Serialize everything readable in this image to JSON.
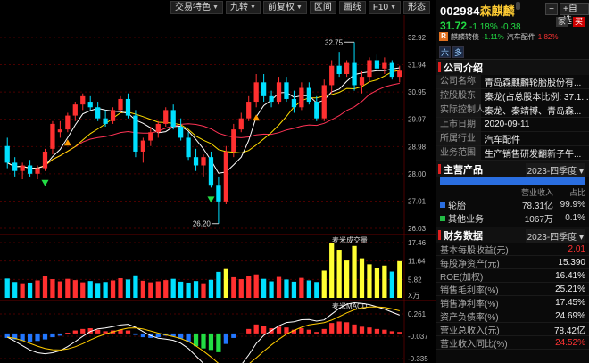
{
  "toolbar": {
    "buttons": [
      {
        "label": "交易特色",
        "caret": true
      },
      {
        "label": "九转",
        "caret": true
      },
      {
        "label": "前复权",
        "caret": true
      },
      {
        "label": "区间",
        "caret": false
      },
      {
        "label": "画线",
        "caret": false
      },
      {
        "label": "F10",
        "caret": true
      },
      {
        "label": "形态",
        "caret": false
      }
    ]
  },
  "chart": {
    "price_axis_labels": [
      "32.92",
      "31.94",
      "30.95",
      "29.97",
      "28.98",
      "28.00",
      "27.01",
      "26.03"
    ],
    "high_marker": "32.75",
    "low_marker": "26.20",
    "volume_title": "麦米成交量",
    "volume_axis_labels": [
      "17.46",
      "11.64",
      "5.82"
    ],
    "volume_unit": "X万",
    "macd_title": "麦米MACD",
    "macd_axis_labels": [
      "0.261",
      "-0.037",
      "-0.335"
    ],
    "colors": {
      "up": "#ff3030",
      "down": "#00e0ff",
      "ma5": "#ffffff",
      "ma10": "#ffdd00",
      "ma20": "#ff3355",
      "grid": "#4a0000"
    }
  },
  "chart_data": [
    {
      "type": "candlestick",
      "ylim": [
        26.03,
        32.92
      ],
      "ohlc": [
        [
          29.0,
          29.3,
          28.2,
          28.4
        ],
        [
          28.4,
          28.6,
          27.9,
          28.1
        ],
        [
          28.1,
          28.4,
          27.8,
          28.3
        ],
        [
          28.3,
          28.5,
          27.9,
          28.0
        ],
        [
          28.0,
          28.3,
          27.8,
          28.2
        ],
        [
          28.2,
          28.9,
          28.1,
          28.8
        ],
        [
          28.9,
          29.9,
          28.7,
          29.8
        ],
        [
          29.5,
          29.9,
          29.3,
          29.6
        ],
        [
          29.6,
          30.2,
          29.5,
          30.1
        ],
        [
          30.1,
          30.6,
          29.9,
          30.5
        ],
        [
          30.5,
          30.9,
          30.3,
          30.8
        ],
        [
          30.6,
          30.8,
          30.3,
          30.4
        ],
        [
          30.4,
          30.6,
          29.9,
          30.0
        ],
        [
          30.0,
          30.3,
          29.7,
          29.8
        ],
        [
          29.9,
          30.4,
          29.8,
          30.3
        ],
        [
          30.3,
          30.8,
          30.2,
          30.7
        ],
        [
          30.7,
          30.9,
          30.0,
          30.1
        ],
        [
          30.1,
          30.3,
          28.6,
          28.8
        ],
        [
          28.8,
          29.3,
          28.4,
          29.2
        ],
        [
          29.2,
          29.7,
          29.0,
          29.5
        ],
        [
          29.5,
          29.9,
          29.3,
          29.8
        ],
        [
          29.8,
          30.4,
          29.7,
          30.3
        ],
        [
          30.3,
          30.5,
          29.6,
          29.7
        ],
        [
          29.7,
          30.0,
          29.2,
          29.3
        ],
        [
          29.3,
          29.5,
          28.5,
          28.6
        ],
        [
          28.6,
          28.9,
          28.1,
          28.3
        ],
        [
          28.3,
          28.7,
          27.9,
          28.6
        ],
        [
          28.6,
          28.8,
          27.5,
          27.6
        ],
        [
          27.6,
          27.9,
          26.2,
          27.0
        ],
        [
          27.0,
          29.0,
          26.9,
          28.8
        ],
        [
          28.8,
          29.8,
          28.6,
          29.6
        ],
        [
          29.6,
          30.2,
          29.5,
          30.0
        ],
        [
          30.0,
          30.8,
          29.9,
          30.6
        ],
        [
          30.6,
          31.6,
          30.4,
          31.3
        ],
        [
          31.3,
          31.6,
          30.6,
          30.8
        ],
        [
          30.8,
          31.0,
          30.4,
          30.6
        ],
        [
          30.6,
          31.5,
          30.5,
          31.3
        ],
        [
          31.3,
          31.5,
          30.6,
          30.7
        ],
        [
          30.7,
          31.0,
          30.2,
          30.4
        ],
        [
          30.4,
          31.3,
          30.3,
          31.1
        ],
        [
          31.1,
          31.3,
          30.5,
          30.6
        ],
        [
          30.6,
          30.8,
          29.9,
          30.0
        ],
        [
          30.0,
          31.4,
          29.9,
          31.2
        ],
        [
          31.2,
          32.1,
          30.9,
          31.9
        ],
        [
          31.9,
          32.4,
          31.5,
          31.6
        ],
        [
          31.6,
          32.1,
          31.5,
          32.0
        ],
        [
          32.0,
          32.75,
          31.0,
          31.2
        ],
        [
          31.2,
          31.7,
          30.9,
          31.5
        ],
        [
          31.5,
          32.2,
          31.3,
          32.1
        ],
        [
          32.1,
          32.3,
          31.7,
          31.8
        ],
        [
          31.8,
          32.2,
          31.6,
          32.0
        ],
        [
          32.0,
          32.1,
          31.4,
          31.5
        ],
        [
          31.5,
          31.9,
          31.3,
          31.72
        ]
      ]
    },
    {
      "type": "bar",
      "name": "volume",
      "ylim": [
        0,
        17.46
      ],
      "values": [
        6.1,
        5.0,
        4.6,
        4.8,
        5.5,
        6.8,
        5.9,
        5.2,
        6.0,
        5.6,
        4.9,
        5.3,
        4.7,
        5.0,
        5.5,
        6.2,
        5.8,
        7.1,
        5.4,
        4.9,
        5.2,
        5.6,
        6.0,
        5.1,
        4.8,
        5.3,
        4.6,
        5.7,
        8.2,
        9.1,
        6.5,
        5.9,
        6.8,
        7.4,
        6.0,
        5.2,
        6.6,
        5.8,
        5.1,
        6.3,
        5.5,
        5.0,
        8.6,
        17.46,
        15.2,
        11.8,
        16.4,
        12.5,
        10.6,
        9.4,
        10.2,
        8.3,
        11.6
      ]
    },
    {
      "type": "bar",
      "name": "MACD",
      "ylim": [
        -0.335,
        0.261
      ],
      "values": [
        -0.06,
        -0.08,
        -0.1,
        -0.11,
        -0.1,
        -0.08,
        -0.05,
        -0.03,
        0.01,
        0.04,
        0.06,
        0.07,
        0.05,
        0.03,
        0.04,
        0.05,
        0.04,
        -0.02,
        -0.05,
        -0.06,
        -0.05,
        -0.03,
        -0.04,
        -0.07,
        -0.12,
        -0.17,
        -0.2,
        -0.22,
        -0.25,
        -0.14,
        -0.06,
        0.0,
        0.06,
        0.12,
        0.1,
        0.07,
        0.09,
        0.08,
        0.05,
        0.07,
        0.05,
        0.02,
        0.06,
        0.14,
        0.16,
        0.15,
        0.12,
        0.09,
        0.08,
        0.06,
        0.05,
        0.03,
        0.02
      ]
    }
  ],
  "panel": {
    "code": "002984",
    "name": "森麒麟",
    "info_badge": "i",
    "minus_label": "−",
    "add_label": "+自选",
    "price": "31.72",
    "change_pct": "-1.18%",
    "change": "-0.38",
    "tag_dark": "冢",
    "tag_red": "买",
    "sub_icon": "R",
    "sub_name": "麒麟转债",
    "sub_pct": "-1.11%",
    "sector_name": "汽车配件",
    "sector_pct": "1.82%",
    "tabs": [
      "六",
      "多"
    ],
    "company_title": "公司介绍",
    "company_rows": [
      {
        "k": "公司名称",
        "v": "青岛森麒麟轮胎股份有..."
      },
      {
        "k": "控股股东",
        "v": "秦龙(占总股本比例: 37.1..."
      },
      {
        "k": "实际控制人",
        "v": "秦龙、秦靖博、青岛森..."
      },
      {
        "k": "上市日期",
        "v": "2020-09-11"
      },
      {
        "k": "所属行业",
        "v": "汽车配件"
      },
      {
        "k": "业务范围",
        "v": "生产销售研发翻新子午..."
      }
    ],
    "product_title": "主营产品",
    "product_period": "2023-四季度",
    "product_cols": [
      "",
      "营业收入",
      "占比"
    ],
    "products": [
      {
        "name": "轮胎",
        "revenue": "78.31亿",
        "pct": "99.9%",
        "color": "#2a6ee0"
      },
      {
        "name": "其他业务",
        "revenue": "1067万",
        "pct": "0.1%",
        "color": "#22bb44"
      }
    ],
    "finance_title": "财务数据",
    "finance_period": "2023-四季度",
    "finance_rows": [
      {
        "k": "基本每股收益(元)",
        "v": "2.01",
        "red": true
      },
      {
        "k": "每股净资产(元)",
        "v": "15.390",
        "red": false
      },
      {
        "k": "ROE(加权)",
        "v": "16.41%",
        "red": false
      },
      {
        "k": "销售毛利率(%)",
        "v": "25.21%",
        "red": false
      },
      {
        "k": "销售净利率(%)",
        "v": "17.45%",
        "red": false
      },
      {
        "k": "资产负债率(%)",
        "v": "24.69%",
        "red": false
      },
      {
        "k": "营业总收入(元)",
        "v": "78.42亿",
        "red": false
      },
      {
        "k": "营业收入同比(%)",
        "v": "24.52%",
        "red": true
      }
    ]
  }
}
